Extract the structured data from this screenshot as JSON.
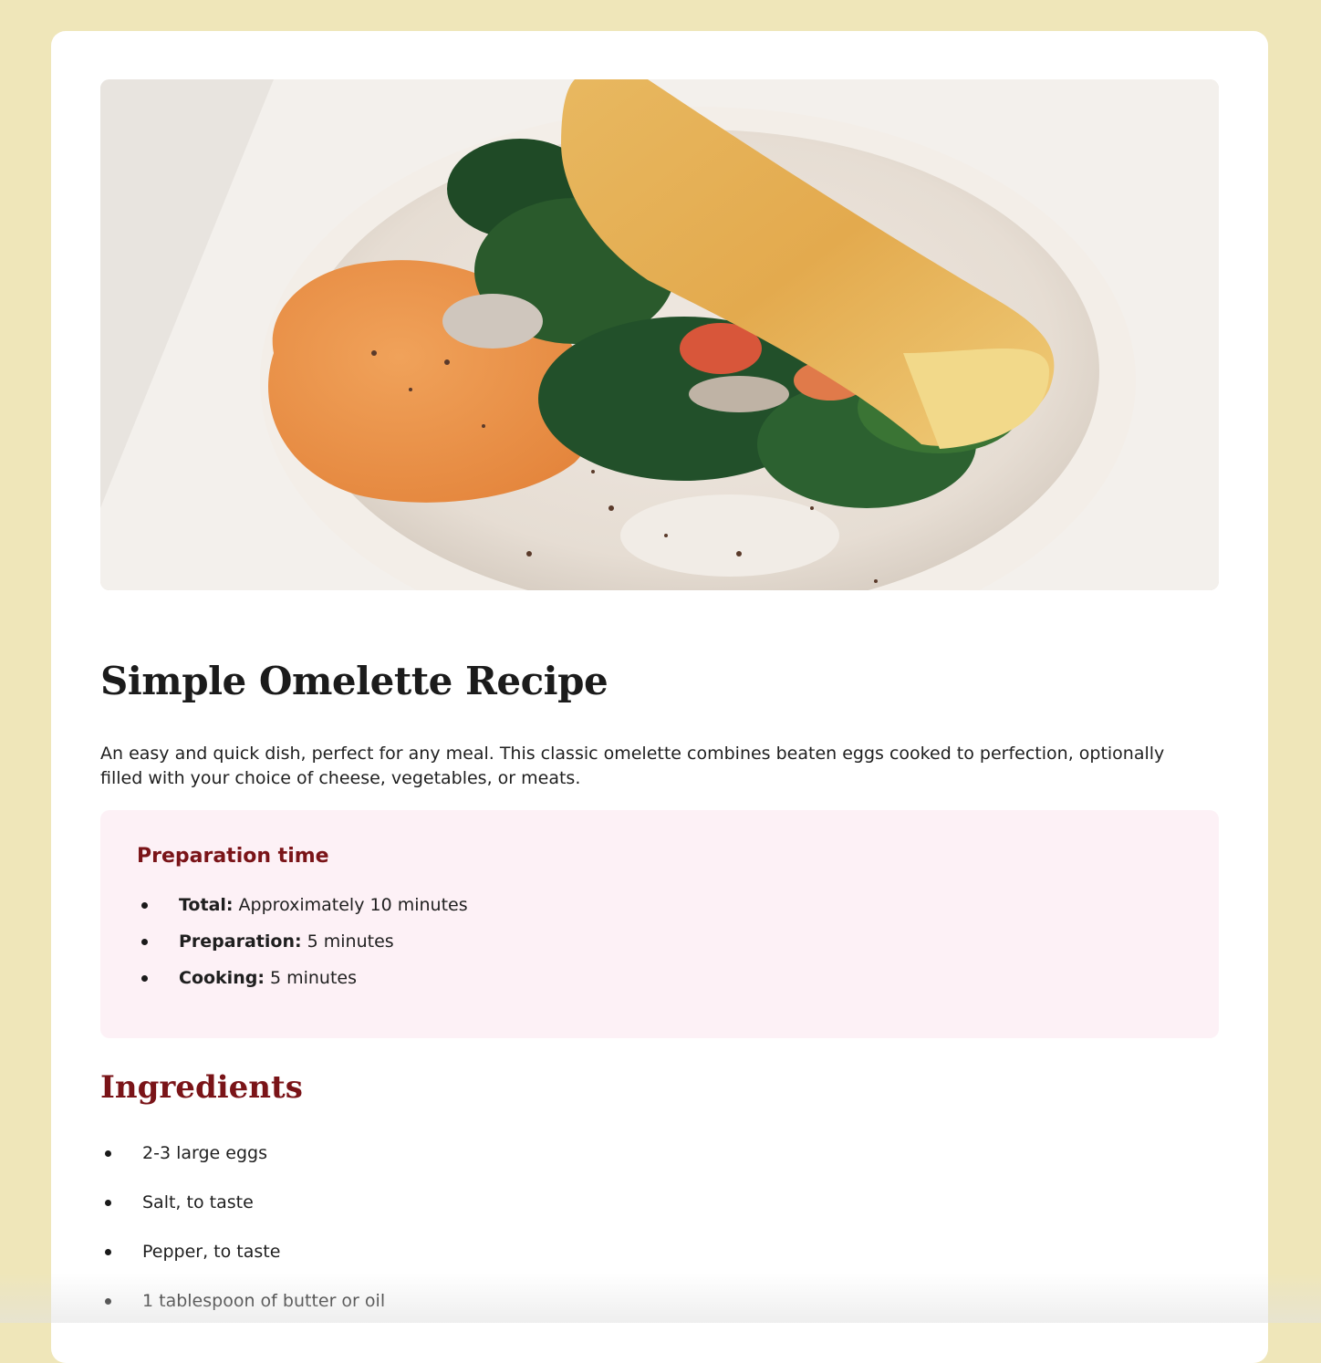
{
  "hero": {
    "alt_name": "omelette-photo"
  },
  "recipe": {
    "title": "Simple Omelette Recipe",
    "intro": "An easy and quick dish, perfect for any meal. This classic omelette combines beaten eggs cooked to perfection, optionally filled with your choice of cheese, vegetables, or meats."
  },
  "prep": {
    "heading": "Preparation time",
    "items": [
      {
        "label": "Total:",
        "value": " Approximately 10 minutes"
      },
      {
        "label": "Preparation:",
        "value": " 5 minutes"
      },
      {
        "label": "Cooking:",
        "value": " 5 minutes"
      }
    ]
  },
  "ingredients": {
    "heading": "Ingredients",
    "items": [
      "2-3 large eggs",
      "Salt, to taste",
      "Pepper, to taste",
      "1 tablespoon of butter or oil"
    ]
  },
  "colors": {
    "page_background": "#efe6b9",
    "card_background": "#ffffff",
    "accent": "#7a1418",
    "prep_background": "#fdf1f6"
  }
}
